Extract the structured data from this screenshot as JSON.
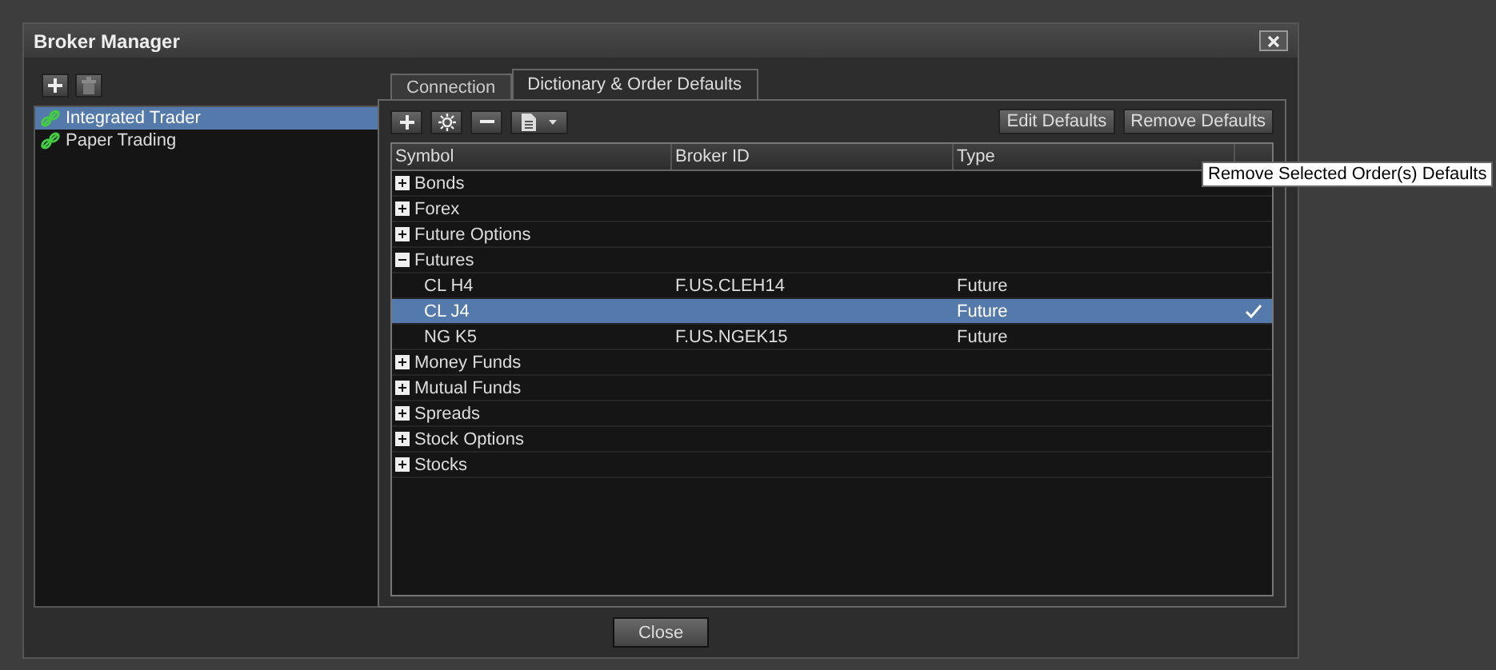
{
  "window": {
    "title": "Broker Manager"
  },
  "brokers": [
    {
      "name": "Integrated Trader",
      "selected": true
    },
    {
      "name": "Paper Trading",
      "selected": false
    }
  ],
  "tabs": [
    {
      "label": "Connection",
      "selected": false
    },
    {
      "label": "Dictionary & Order Defaults",
      "selected": true
    }
  ],
  "toolbar": {
    "buttons": [
      "Edit Defaults",
      "Remove Defaults"
    ]
  },
  "table": {
    "columns": [
      "Symbol",
      "Broker ID",
      "Type"
    ],
    "rows": [
      {
        "symbol": "Bonds",
        "expanded": false
      },
      {
        "symbol": "Forex",
        "expanded": false
      },
      {
        "symbol": "Future Options",
        "expanded": false
      },
      {
        "symbol": "Futures",
        "expanded": true,
        "children": [
          {
            "symbol": "CL H4",
            "broker_id": "F.US.CLEH14",
            "type": "Future",
            "selected": false,
            "checked": false
          },
          {
            "symbol": "CL J4",
            "type": "Future",
            "selected": true,
            "checked": true
          },
          {
            "symbol": "NG K5",
            "broker_id": "F.US.NGEK15",
            "type": "Future",
            "selected": false,
            "checked": false
          }
        ]
      },
      {
        "symbol": "Money Funds",
        "expanded": false
      },
      {
        "symbol": "Mutual Funds",
        "expanded": false
      },
      {
        "symbol": "Spreads",
        "expanded": false
      },
      {
        "symbol": "Stock Options",
        "expanded": false
      },
      {
        "symbol": "Stocks",
        "expanded": false
      }
    ]
  },
  "tooltip": "Remove Selected Order(s) Defaults",
  "footer": {
    "button": "Close"
  }
}
